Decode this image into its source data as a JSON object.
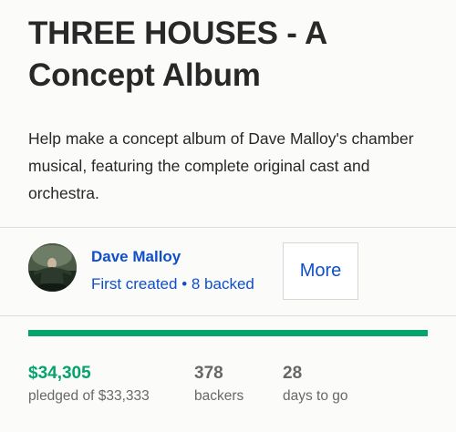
{
  "project": {
    "title": "THREE HOUSES - A Concept Album",
    "blurb": "Help make a concept album of Dave Malloy's chamber musical, featuring the complete original cast and orchestra."
  },
  "creator": {
    "name": "Dave Malloy",
    "meta": "First created • 8 backed",
    "more_label": "More"
  },
  "funding": {
    "progress_fraction": 1.0,
    "pledged_value": "$34,305",
    "pledged_label": "pledged of $33,333",
    "backers_value": "378",
    "backers_label": "backers",
    "days_value": "28",
    "days_label": "days to go"
  },
  "colors": {
    "accent_green": "#05a36e",
    "link_blue": "#0f4fc9",
    "text_dark": "#282828",
    "text_muted": "#686868"
  },
  "icons": {
    "avatar": "creator-avatar-photo"
  }
}
